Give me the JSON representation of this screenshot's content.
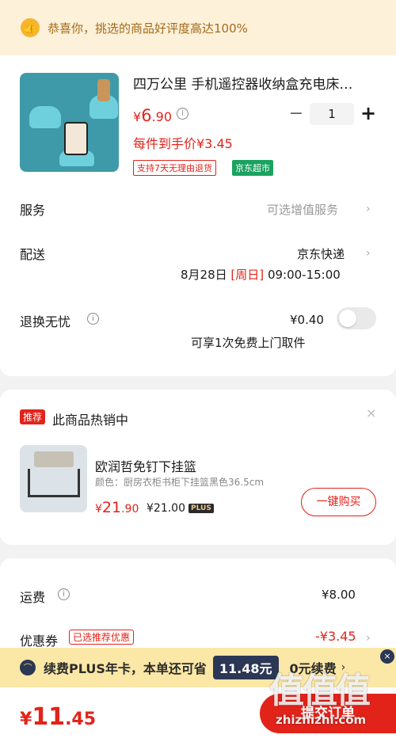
{
  "banner": {
    "text": "恭喜你，挑选的商品好评度高达100%"
  },
  "product": {
    "title": "四万公里 手机遥控器收纳盒充电床…",
    "price_symbol": "¥",
    "price_int": "6",
    "price_dec": ".90",
    "unit_price": "每件到手价¥3.45",
    "tag_return": "支持7天无理由退货",
    "tag_store": "京东超市",
    "quantity": "1",
    "minus": "−",
    "plus": "+"
  },
  "service": {
    "label": "服务",
    "value": "可选增值服务"
  },
  "delivery": {
    "label": "配送",
    "carrier": "京东快递",
    "date": "8月28日",
    "bracket_open": "[",
    "weekday": "周日",
    "bracket_close": "]",
    "time": "09:00-15:00"
  },
  "return_worry": {
    "label": "退换无忧",
    "price": "¥0.40",
    "desc": "可享1次免费上门取件"
  },
  "recommend": {
    "badge": "推荐",
    "title": "此商品热销中",
    "close": "×",
    "name": "欧润哲免钉下挂篮",
    "spec": "颜色：厨房衣柜书柜下挂篮黑色36.5cm",
    "price_symbol": "¥",
    "price_int": "21",
    "price_dec": ".90",
    "plus_price": "¥21.00",
    "plus_tag": "PLUS",
    "buy_label": "一键购买"
  },
  "fees": {
    "shipping_label": "运费",
    "shipping_value": "¥8.00",
    "coupon_label": "优惠券",
    "coupon_tag": "已选推荐优惠",
    "coupon_value": "-¥3.45"
  },
  "plus_bar": {
    "text": "续费PLUS年卡，本单还可省",
    "amount": "11.48元",
    "renew": "0元续费",
    "chevron": "›",
    "close": "×"
  },
  "bottom": {
    "total_symbol": "¥",
    "total_int": "11",
    "total_dec": ".45",
    "submit_label": "提交订单"
  },
  "watermark": {
    "glyphs": "值值值",
    "domain": "zhizhizhi.com"
  },
  "colors": {
    "accent": "#e2231a",
    "banner_bg": "#fdf1da",
    "plus_bar_bg": "#fbe7a6",
    "jd_green": "#1aa260"
  }
}
